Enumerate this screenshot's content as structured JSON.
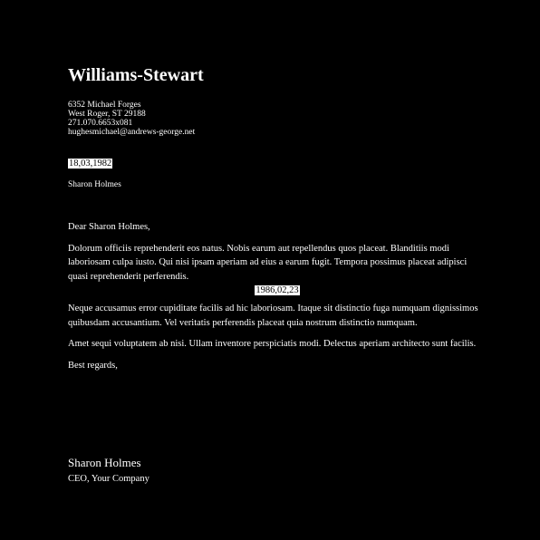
{
  "letterhead": {
    "company": "Williams-Stewart",
    "address_line1": "6352 Michael Forges",
    "address_line2": "West Roger, ST 29188",
    "phone": "271.070.6653x081",
    "email": "hughesmichael@andrews-george.net"
  },
  "letter": {
    "date": "18,03,1982",
    "recipient": "Sharon Holmes",
    "salutation": "Dear Sharon Holmes,",
    "paragraph1": "Dolorum officiis reprehenderit eos natus. Nobis earum aut repellendus quos placeat. Blanditiis modi laboriosam culpa iusto. Qui nisi ipsam aperiam ad eius a earum fugit. Tempora possimus placeat adipisci quasi reprehenderit perferendis.",
    "inline_date": "1986,02,23",
    "paragraph2": "Neque accusamus error cupiditate facilis ad hic laboriosam. Itaque sit distinctio fuga numquam dignissimos quibusdam accusantium. Vel veritatis perferendis placeat quia nostrum distinctio numquam.",
    "paragraph3": "Amet sequi voluptatem ab nisi. Ullam inventore perspiciatis modi. Delectus aperiam architecto sunt facilis.",
    "closing": "Best regards,"
  },
  "signature": {
    "name": "Sharon Holmes",
    "title": "CEO, Your Company"
  }
}
